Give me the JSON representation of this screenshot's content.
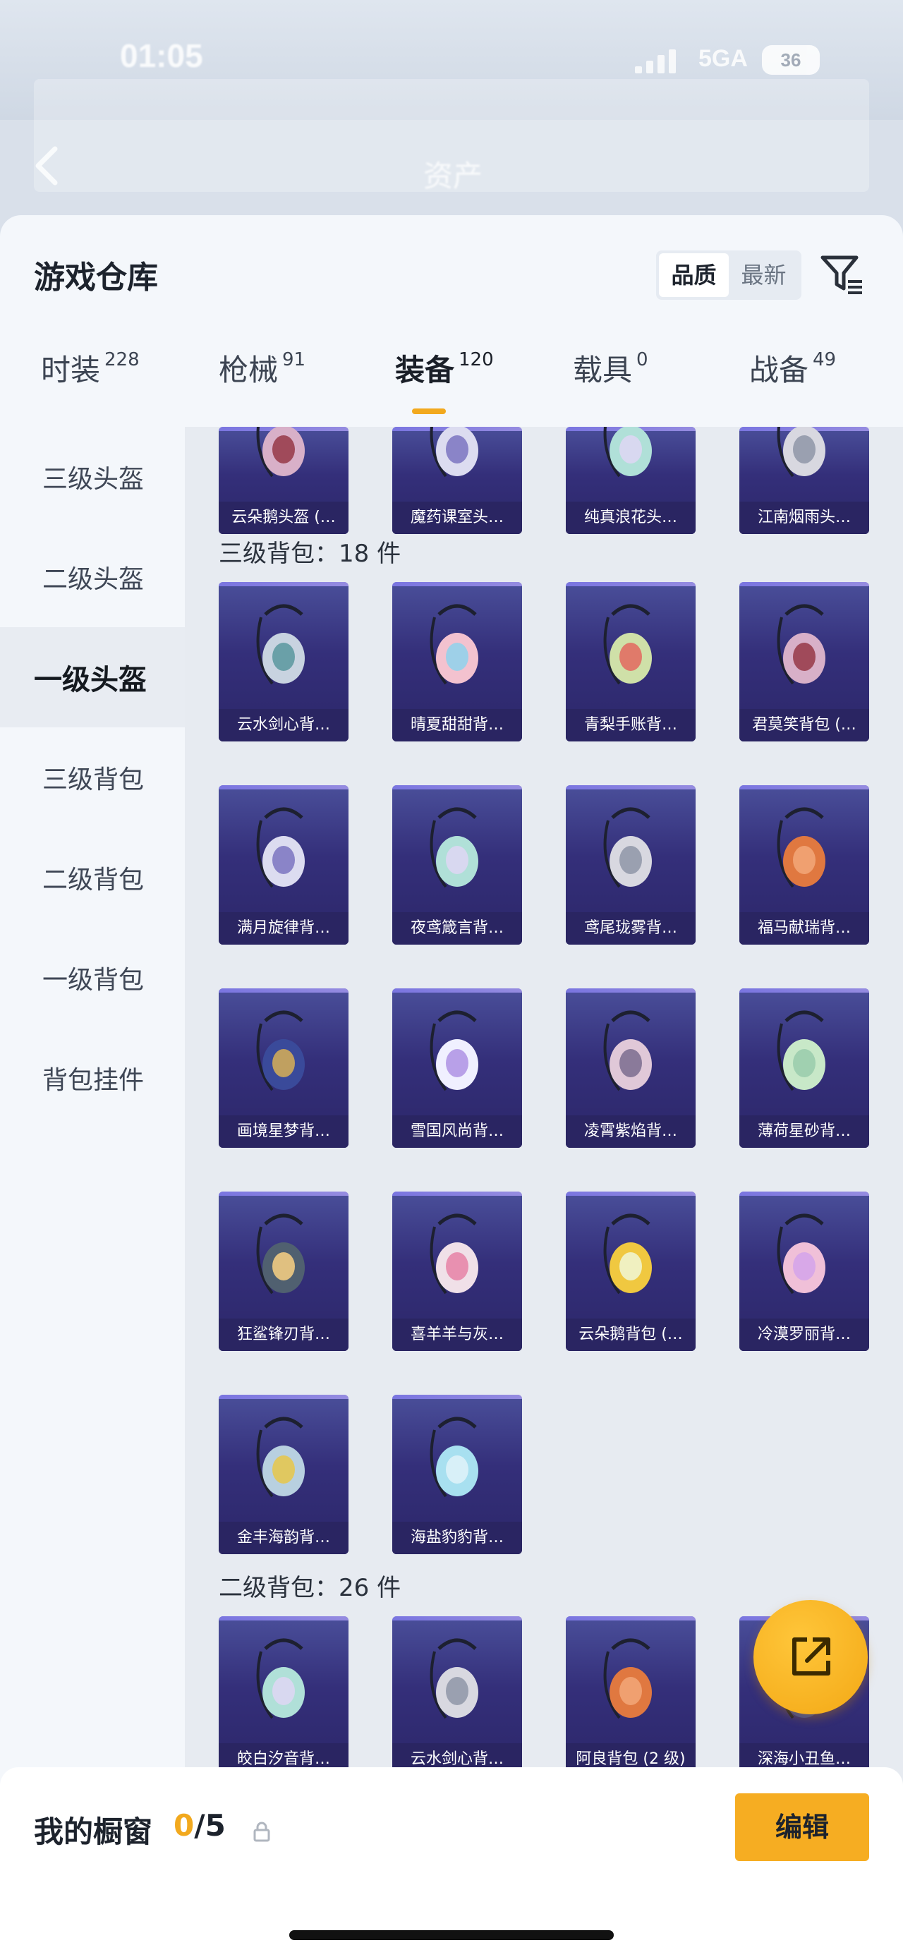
{
  "status": {
    "time": "01:05",
    "network": "5GA",
    "battery": "36"
  },
  "header": {
    "title": "资产"
  },
  "sheet": {
    "title": "游戏仓库",
    "sort_options": [
      "品质",
      "最新"
    ],
    "tabs": [
      {
        "label": "时装",
        "count": "228"
      },
      {
        "label": "枪械",
        "count": "91"
      },
      {
        "label": "装备",
        "count": "120"
      },
      {
        "label": "载具",
        "count": "0"
      },
      {
        "label": "战备",
        "count": "49"
      }
    ]
  },
  "sidebar": {
    "items": [
      "三级头盔",
      "二级头盔",
      "一级头盔",
      "三级背包",
      "二级背包",
      "一级背包",
      "背包挂件"
    ],
    "active": "一级头盔"
  },
  "grid": {
    "top_row": [
      "云朵鹅头盔 (…",
      "魔药课室头…",
      "纯真浪花头…",
      "江南烟雨头…"
    ],
    "section1": {
      "label": "三级背包：18 件"
    },
    "section1_items": [
      "云水剑心背…",
      "晴夏甜甜背…",
      "青梨手账背…",
      "君莫笑背包 (…",
      "满月旋律背…",
      "夜鸢箴言背…",
      "鸢尾珑雾背…",
      "福马献瑞背…",
      "画境星梦背…",
      "雪国风尚背…",
      "凌霄紫焰背…",
      "薄荷星砂背…",
      "狂鲨锋刃背…",
      "喜羊羊与灰…",
      "云朵鹅背包 (…",
      "冷漠罗丽背…",
      "金丰海韵背…",
      "海盐豹豹背…"
    ],
    "section2": {
      "label": "二级背包：26 件"
    },
    "section2_items": [
      "皎白汐音背…",
      "云水剑心背…",
      "阿良背包 (2 级)",
      "深海小丑鱼…"
    ]
  },
  "bottom": {
    "showcase_label": "我的橱窗",
    "used": "0",
    "total": "/5",
    "edit_label": "编辑"
  },
  "colors": {
    "accent": "#f6ad22",
    "card_bg": "#342f7a"
  }
}
